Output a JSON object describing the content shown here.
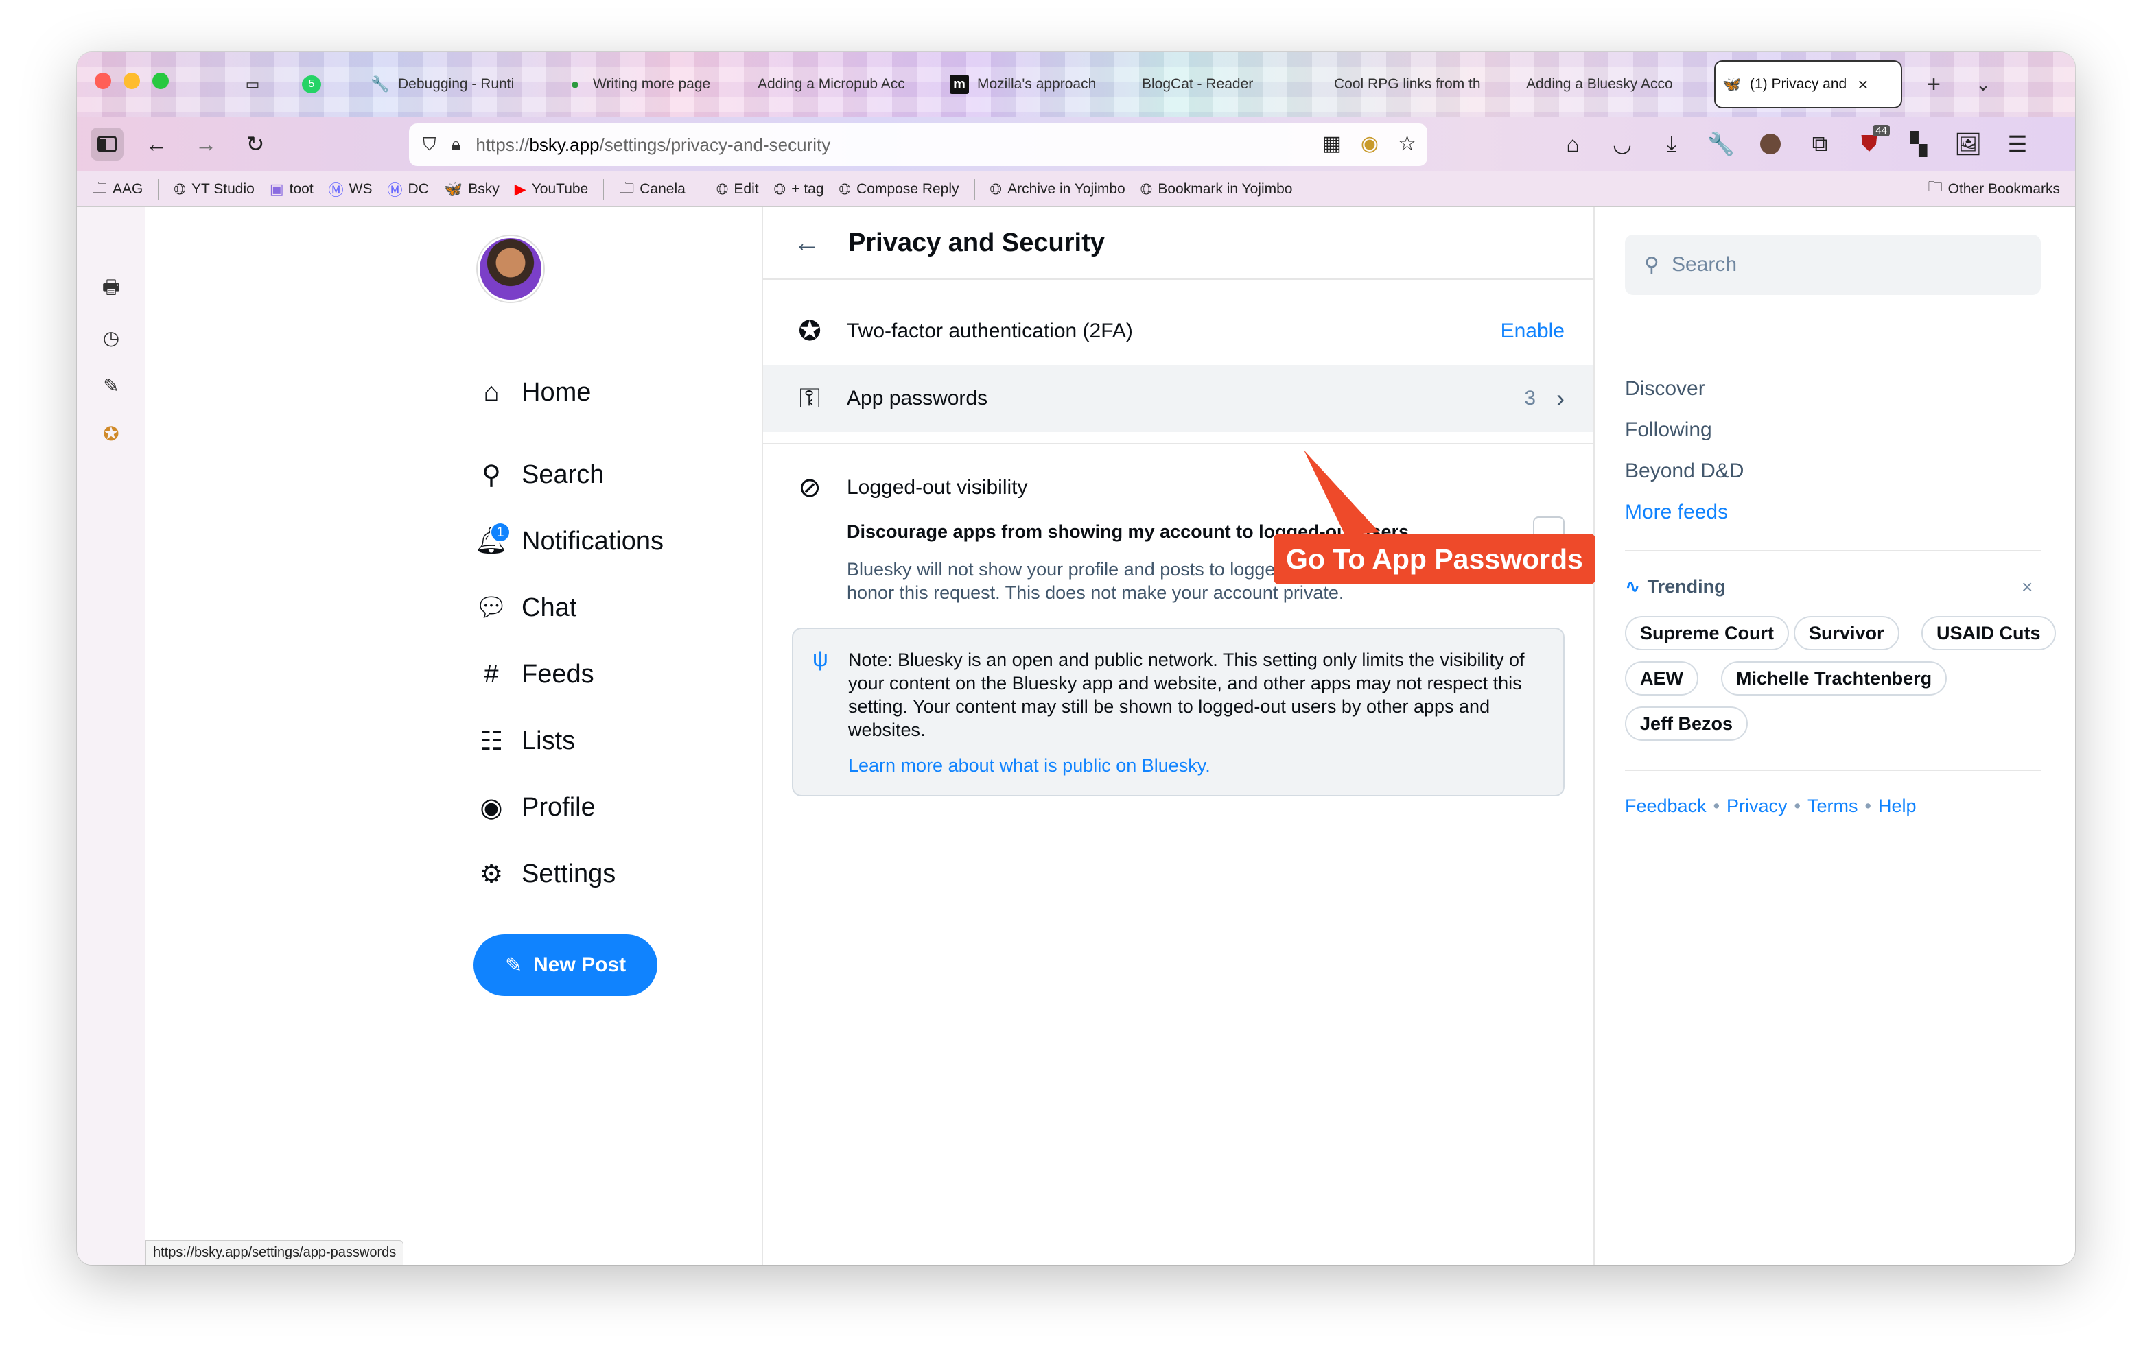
{
  "browser": {
    "tabs": [
      {
        "label": "",
        "icon": "tab-overview-icon"
      },
      {
        "label": "",
        "icon": "whatsapp-icon",
        "badge": "5"
      },
      {
        "label": "Debugging - Runti",
        "icon": "wrench-icon"
      },
      {
        "label": "Writing more page",
        "icon": "frog-icon"
      },
      {
        "label": "Adding a Micropub Acc",
        "icon": ""
      },
      {
        "label": "Mozilla's approach",
        "icon": "m-logo-icon"
      },
      {
        "label": "BlogCat - Reader",
        "icon": ""
      },
      {
        "label": "Cool RPG links from th",
        "icon": ""
      },
      {
        "label": "Adding a Bluesky Acco",
        "icon": ""
      },
      {
        "label": "(1) Privacy and",
        "icon": "butterfly-icon",
        "active": true
      }
    ],
    "url": {
      "scheme": "https://",
      "host": "bsky.app",
      "path": "/settings/privacy-and-security"
    },
    "toolbar_badge": "44",
    "bookmarks": [
      {
        "label": "AAG",
        "icon": "folder-icon"
      },
      {
        "label": "YT Studio",
        "icon": "globe-icon"
      },
      {
        "label": "toot",
        "icon": "toot-icon"
      },
      {
        "label": "WS",
        "icon": "mastodon-icon"
      },
      {
        "label": "DC",
        "icon": "mastodon-icon"
      },
      {
        "label": "Bsky",
        "icon": "butterfly-icon"
      },
      {
        "label": "YouTube",
        "icon": "youtube-icon"
      },
      {
        "label": "Canela",
        "icon": "folder-icon"
      },
      {
        "label": "Edit",
        "icon": "globe-icon"
      },
      {
        "label": "+ tag",
        "icon": "globe-icon"
      },
      {
        "label": "Compose Reply",
        "icon": "globe-icon"
      },
      {
        "label": "Archive in Yojimbo",
        "icon": "globe-icon"
      },
      {
        "label": "Bookmark in Yojimbo",
        "icon": "globe-icon"
      }
    ],
    "other_bookmarks": "Other Bookmarks",
    "status_url": "https://bsky.app/settings/app-passwords"
  },
  "nav": {
    "items": [
      {
        "label": "Home",
        "icon": "home-icon"
      },
      {
        "label": "Search",
        "icon": "search-icon"
      },
      {
        "label": "Notifications",
        "icon": "bell-icon",
        "badge": "1"
      },
      {
        "label": "Chat",
        "icon": "chat-icon"
      },
      {
        "label": "Feeds",
        "icon": "hash-icon"
      },
      {
        "label": "Lists",
        "icon": "list-icon"
      },
      {
        "label": "Profile",
        "icon": "profile-icon"
      },
      {
        "label": "Settings",
        "icon": "gear-icon"
      }
    ],
    "new_post": "New Post"
  },
  "main": {
    "title": "Privacy and Security",
    "twofa": {
      "label": "Two-factor authentication (2FA)",
      "action": "Enable"
    },
    "app_passwords": {
      "label": "App passwords",
      "count": "3"
    },
    "visibility": {
      "heading": "Logged-out visibility",
      "option": "Discourage apps from showing my account to logged-out users",
      "description": "Bluesky will not show your profile and posts to logged-out users. Other apps may not honor this request. This does not make your account private."
    },
    "note": {
      "text": "Note: Bluesky is an open and public network. This setting only limits the visibility of your content on the Bluesky app and website, and other apps may not respect this setting. Your content may still be shown to logged-out users by other apps and websites.",
      "link": "Learn more about what is public on Bluesky."
    }
  },
  "callout": "Go To App Passwords",
  "right": {
    "search_placeholder": "Search",
    "feeds": [
      "Discover",
      "Following",
      "Beyond D&D"
    ],
    "more_feeds": "More feeds",
    "trending_label": "Trending",
    "trending": [
      "Supreme Court",
      "Survivor",
      "USAID Cuts",
      "AEW",
      "Michelle Trachtenberg",
      "Jeff Bezos"
    ],
    "footer": [
      "Feedback",
      "Privacy",
      "Terms",
      "Help"
    ]
  },
  "colors": {
    "accent": "#1083fe",
    "callout": "#ee4a2a"
  }
}
